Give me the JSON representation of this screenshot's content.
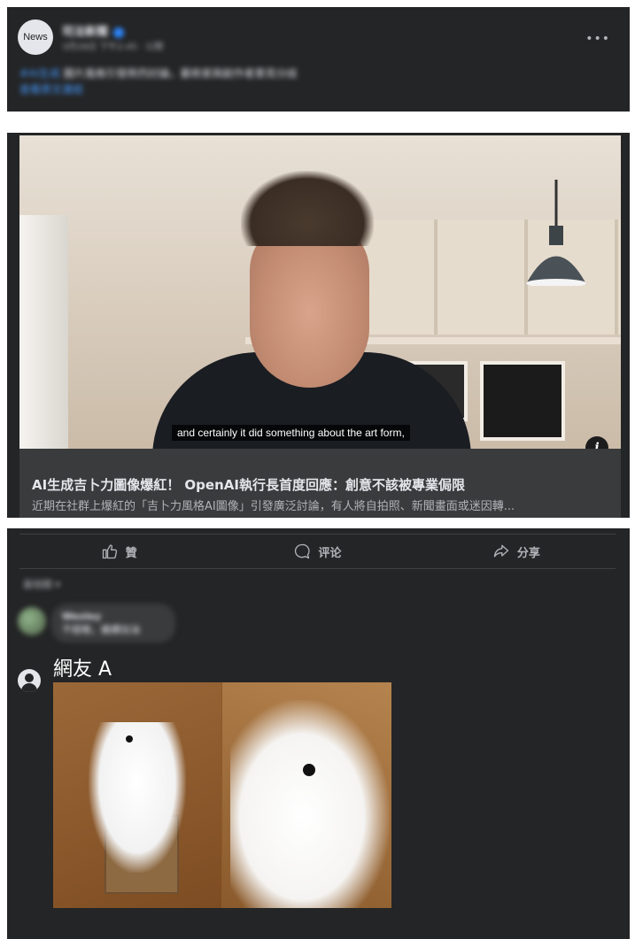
{
  "post": {
    "avatar_label": "News",
    "page_name": "司法新聞",
    "meta": "3月28日 下午2:45 · 公開",
    "text_tag": "#AI生成",
    "text": "圖片風格引發熱烈討論，藝術家與創作者意見分歧",
    "text_link": "查看原文連結",
    "more_icon": "more-horizontal-icon"
  },
  "video": {
    "subtitle": "and certainly it did something about the art form,",
    "info_label": "i"
  },
  "link_preview": {
    "headline": "AI生成吉卜力圖像爆紅！ OpenAI執行長首度回應：創意不該被專業侷限",
    "description": "近期在社群上爆紅的「吉卜力風格AI圖像」引發廣泛討論，有人將自拍照、新聞畫面或迷因轉..."
  },
  "actions": {
    "like": "贊",
    "comment": "评论",
    "share": "分享"
  },
  "comments": {
    "sort_label": "最相關",
    "first": {
      "name": "Wesley",
      "text": "不錯喔，繼續加油"
    },
    "netizen_name": "網友 A"
  }
}
